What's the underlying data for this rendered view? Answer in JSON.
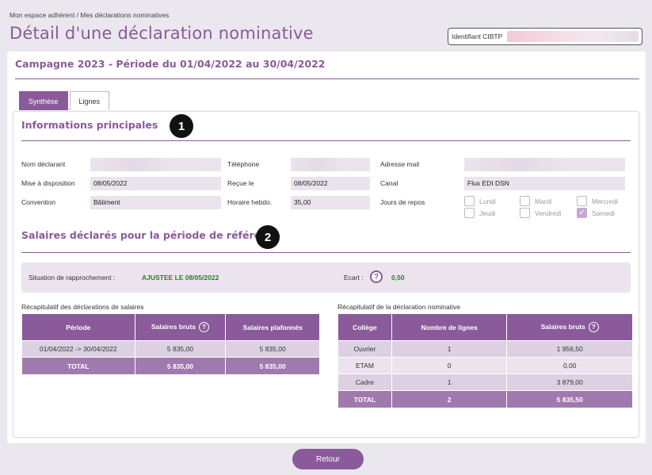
{
  "header": {
    "breadcrumb": "Mon espace adhérent / Mes déclarations nominatives",
    "title": "Détail d'une déclaration nominative",
    "cibtp_label": "Identifiant CIBTP"
  },
  "campaign": "Campagne 2023 - Période du 01/04/2022 au 30/04/2022",
  "tabs": [
    {
      "label": "Synthèse",
      "active": true
    },
    {
      "label": "Lignes",
      "active": false
    }
  ],
  "info": {
    "title": "Informations principales",
    "badge": "1",
    "nom_declarant_label": "Nom déclarant",
    "telephone_label": "Téléphone",
    "adresse_mail_label": "Adresse mail",
    "mise_a_disposition_label": "Mise à disposition",
    "mise_a_disposition_value": "08/05/2022",
    "recue_le_label": "Reçue le",
    "recue_le_value": "08/05/2022",
    "canal_label": "Canal",
    "canal_value": "Flux EDI DSN",
    "convention_label": "Convention",
    "convention_value": "Bâtiment",
    "horaire_label": "Horaire hebdo.",
    "horaire_value": "35,00",
    "jours_label": "Jours de repos",
    "jours": [
      {
        "label": "Lundi",
        "checked": false
      },
      {
        "label": "Mardi",
        "checked": false
      },
      {
        "label": "Mercredi",
        "checked": false
      },
      {
        "label": "Jeudi",
        "checked": false
      },
      {
        "label": "Vendredi",
        "checked": false
      },
      {
        "label": "Samedi",
        "checked": true
      }
    ]
  },
  "salaires": {
    "title": "Salaires déclarés pour la période de référence",
    "badge": "2",
    "rapprochement_label": "Situation de rapprochement :",
    "rapprochement_value": "AJUSTEE LE 08/05/2022",
    "ecart_label": "Ecart :",
    "ecart_value": "0,50",
    "help_glyph": "?"
  },
  "recap_salaires": {
    "caption": "Récapitulatif des déclarations de salaires",
    "headers": [
      "Période",
      "Salaires bruts",
      "Salaires plafonnés"
    ],
    "rows": [
      [
        "01/04/2022 -> 30/04/2022",
        "5 835,00",
        "5 835,00"
      ]
    ],
    "total": [
      "TOTAL",
      "5 835,00",
      "5 835,00"
    ]
  },
  "recap_nominative": {
    "caption": "Récapitulatif de la déclaration nominative",
    "headers": [
      "Collège",
      "Nombre de lignes",
      "Salaires bruts"
    ],
    "rows": [
      [
        "Ouvrier",
        "1",
        "1 956,50"
      ],
      [
        "ETAM",
        "0",
        "0,00"
      ],
      [
        "Cadre",
        "1",
        "3 879,00"
      ]
    ],
    "total": [
      "TOTAL",
      "2",
      "5 835,50"
    ]
  },
  "retour_label": "Retour"
}
